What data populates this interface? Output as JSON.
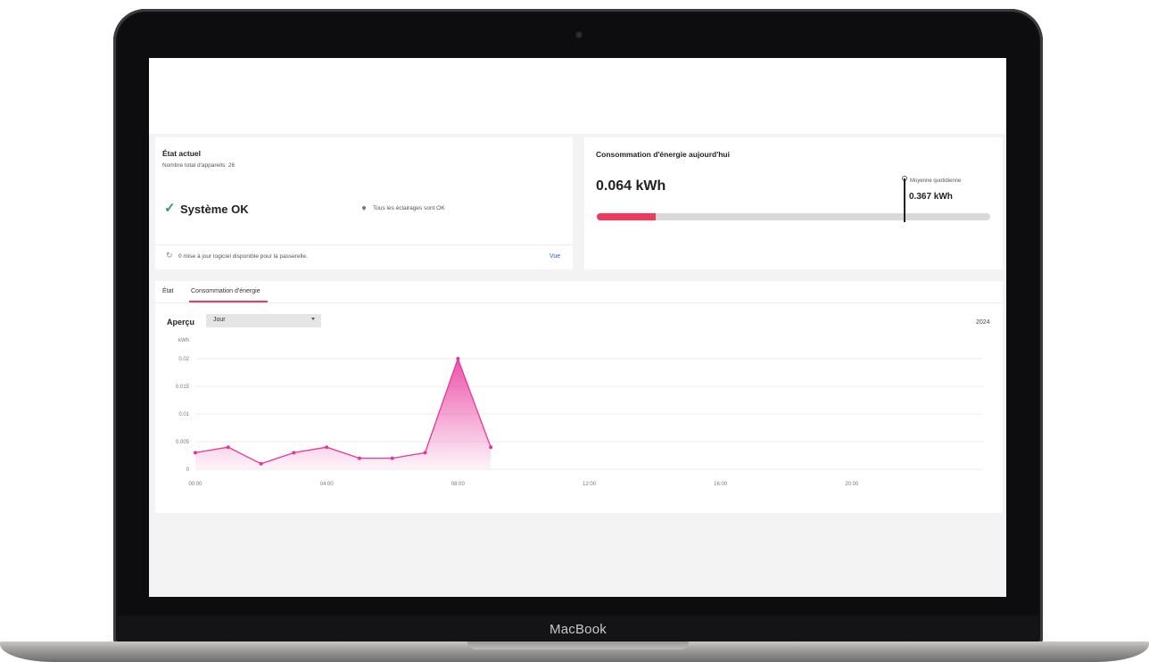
{
  "device": {
    "brand_label": "MacBook"
  },
  "status_card": {
    "title": "État actuel",
    "device_count": "Nombre total d'appareils: 26",
    "system_status": "Système OK",
    "lighting_status": "Tous les éclairages sont OK",
    "update_text": "0 mise à jour logiciel disponible pour la passerelle.",
    "update_link": "Vue"
  },
  "energy_card": {
    "title": "Consommation d'énergie aujourd'hui",
    "today_value": "0.064 kWh",
    "avg_label": "Moyenne quotidienne",
    "avg_value": "0.367 kWh",
    "today_kwh": 0.064,
    "avg_kwh": 0.367,
    "bar_max_kwh": 0.43,
    "fill_color": "#f0395d"
  },
  "tabs": [
    {
      "label": "État",
      "active": false
    },
    {
      "label": "Consommation d'énergie",
      "active": true
    }
  ],
  "overview": {
    "label": "Aperçu",
    "period_selected": "Jour",
    "year": "2024"
  },
  "chart_data": {
    "type": "area",
    "ylabel": "kWh",
    "x": [
      "00:00",
      "01:00",
      "02:00",
      "03:00",
      "04:00",
      "05:00",
      "06:00",
      "07:00",
      "08:00",
      "09:00"
    ],
    "values": [
      0.003,
      0.004,
      0.001,
      0.003,
      0.004,
      0.002,
      0.002,
      0.003,
      0.02,
      0.004
    ],
    "x_ticks": [
      "00:00",
      "04:00",
      "08:00",
      "12:00",
      "16:00",
      "20:00"
    ],
    "y_ticks": [
      "0",
      "0.005",
      "0.01",
      "0.015",
      "0.02"
    ],
    "ylim": [
      0,
      0.02
    ],
    "xlim_hours": [
      0,
      24
    ],
    "grid": true,
    "color": "#e8359c"
  }
}
